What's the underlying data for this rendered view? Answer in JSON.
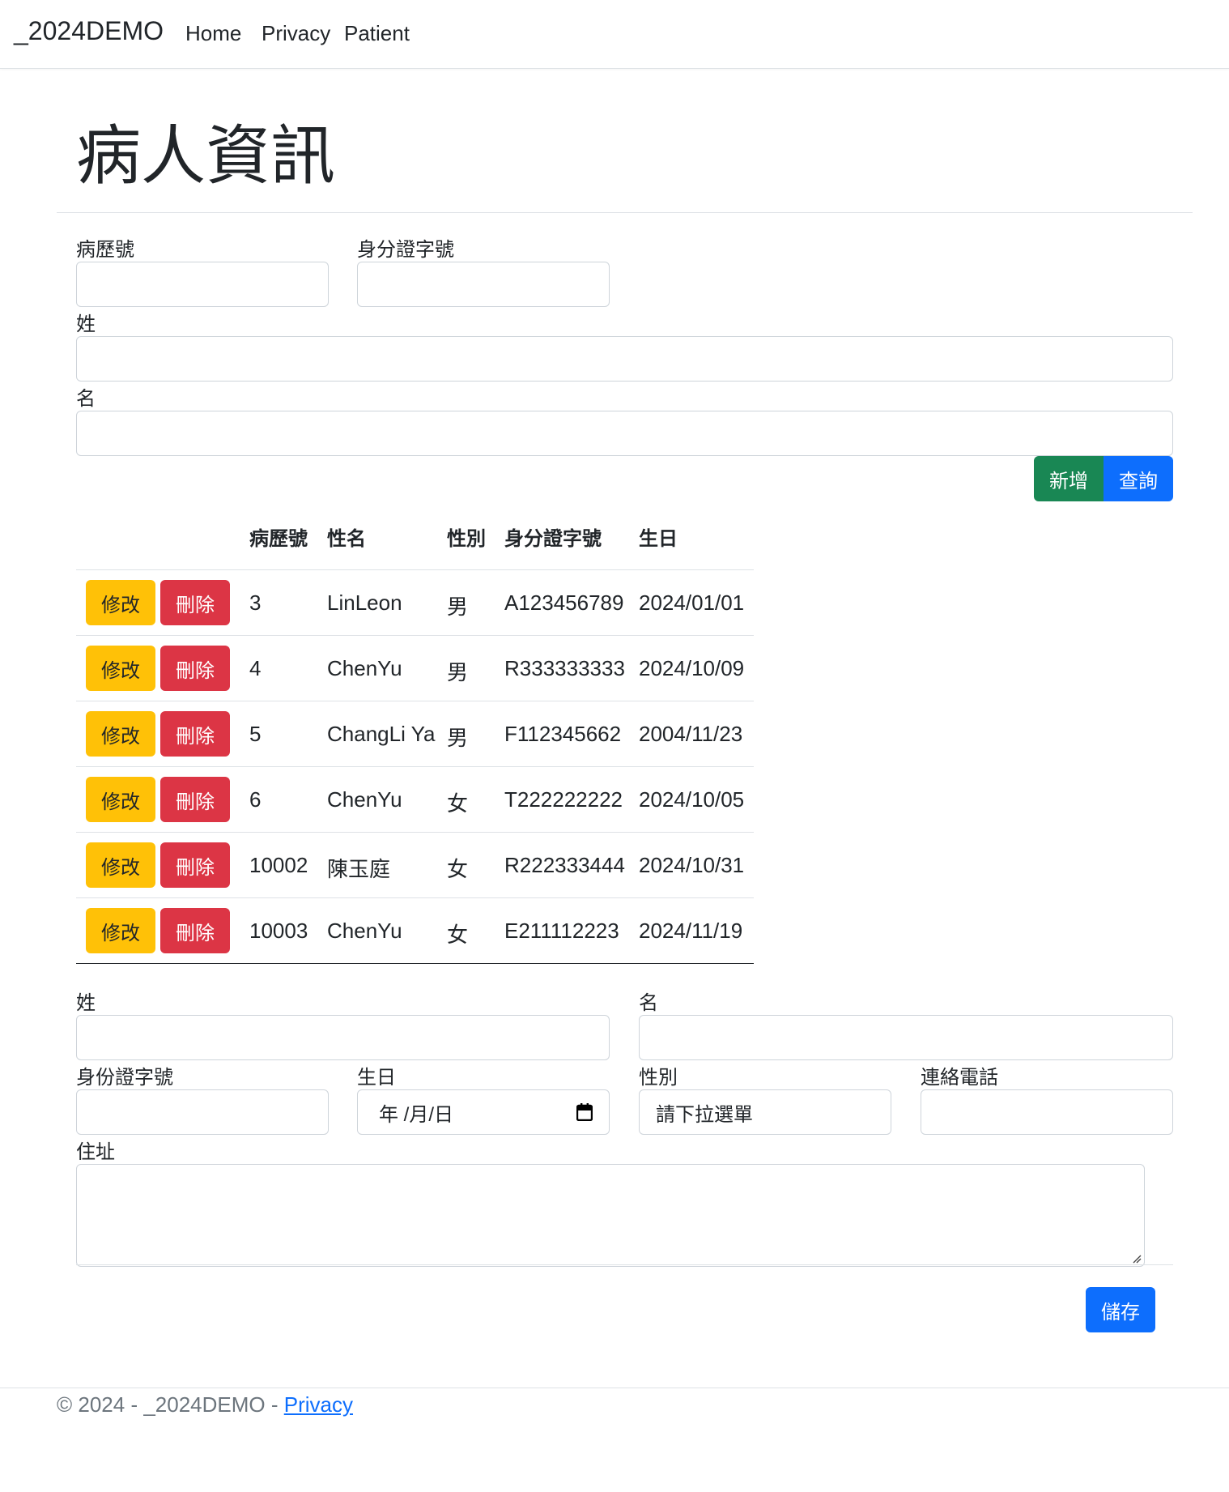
{
  "nav": {
    "brand": "_2024DEMO",
    "links": [
      "Home",
      "Privacy",
      "Patient"
    ]
  },
  "page_title": "病人資訊",
  "search_form": {
    "record_no_label": "病歷號",
    "id_no_label": "身分證字號",
    "last_name_label": "姓",
    "first_name_label": "名",
    "add_button": "新增",
    "query_button": "查詢"
  },
  "table": {
    "headers": [
      "",
      "病歷號",
      "性名",
      "性別",
      "身分證字號",
      "生日"
    ],
    "edit_label": "修改",
    "delete_label": "刪除",
    "rows": [
      [
        "3",
        "LinLeon",
        "男",
        "A123456789",
        "2024/01/01"
      ],
      [
        "4",
        "ChenYu",
        "男",
        "R333333333",
        "2024/10/09"
      ],
      [
        "5",
        "ChangLi Ya",
        "男",
        "F112345662",
        "2004/11/23"
      ],
      [
        "6",
        "ChenYu",
        "女",
        "T222222222",
        "2024/10/05"
      ],
      [
        "10002",
        "陳玉庭",
        "女",
        "R222333444",
        "2024/10/31"
      ],
      [
        "10003",
        "ChenYu",
        "女",
        "E211112223",
        "2024/11/19"
      ]
    ]
  },
  "edit_form": {
    "last_name_label": "姓",
    "first_name_label": "名",
    "id_no_label": "身份證字號",
    "birthday_label": "生日",
    "birthday_placeholder": "年 /月/日",
    "gender_label": "性別",
    "gender_placeholder": "請下拉選單",
    "phone_label": "連絡電話",
    "address_label": "住址",
    "save_button": "儲存"
  },
  "footer": {
    "text": "© 2024 - _2024DEMO - ",
    "link": "Privacy"
  },
  "colors": {
    "primary": "#0d6efd",
    "success": "#198754",
    "warning": "#ffc107",
    "danger": "#dc3545"
  },
  "icons": {
    "calendar": "calendar-icon",
    "resize": "resize-grip-icon"
  }
}
